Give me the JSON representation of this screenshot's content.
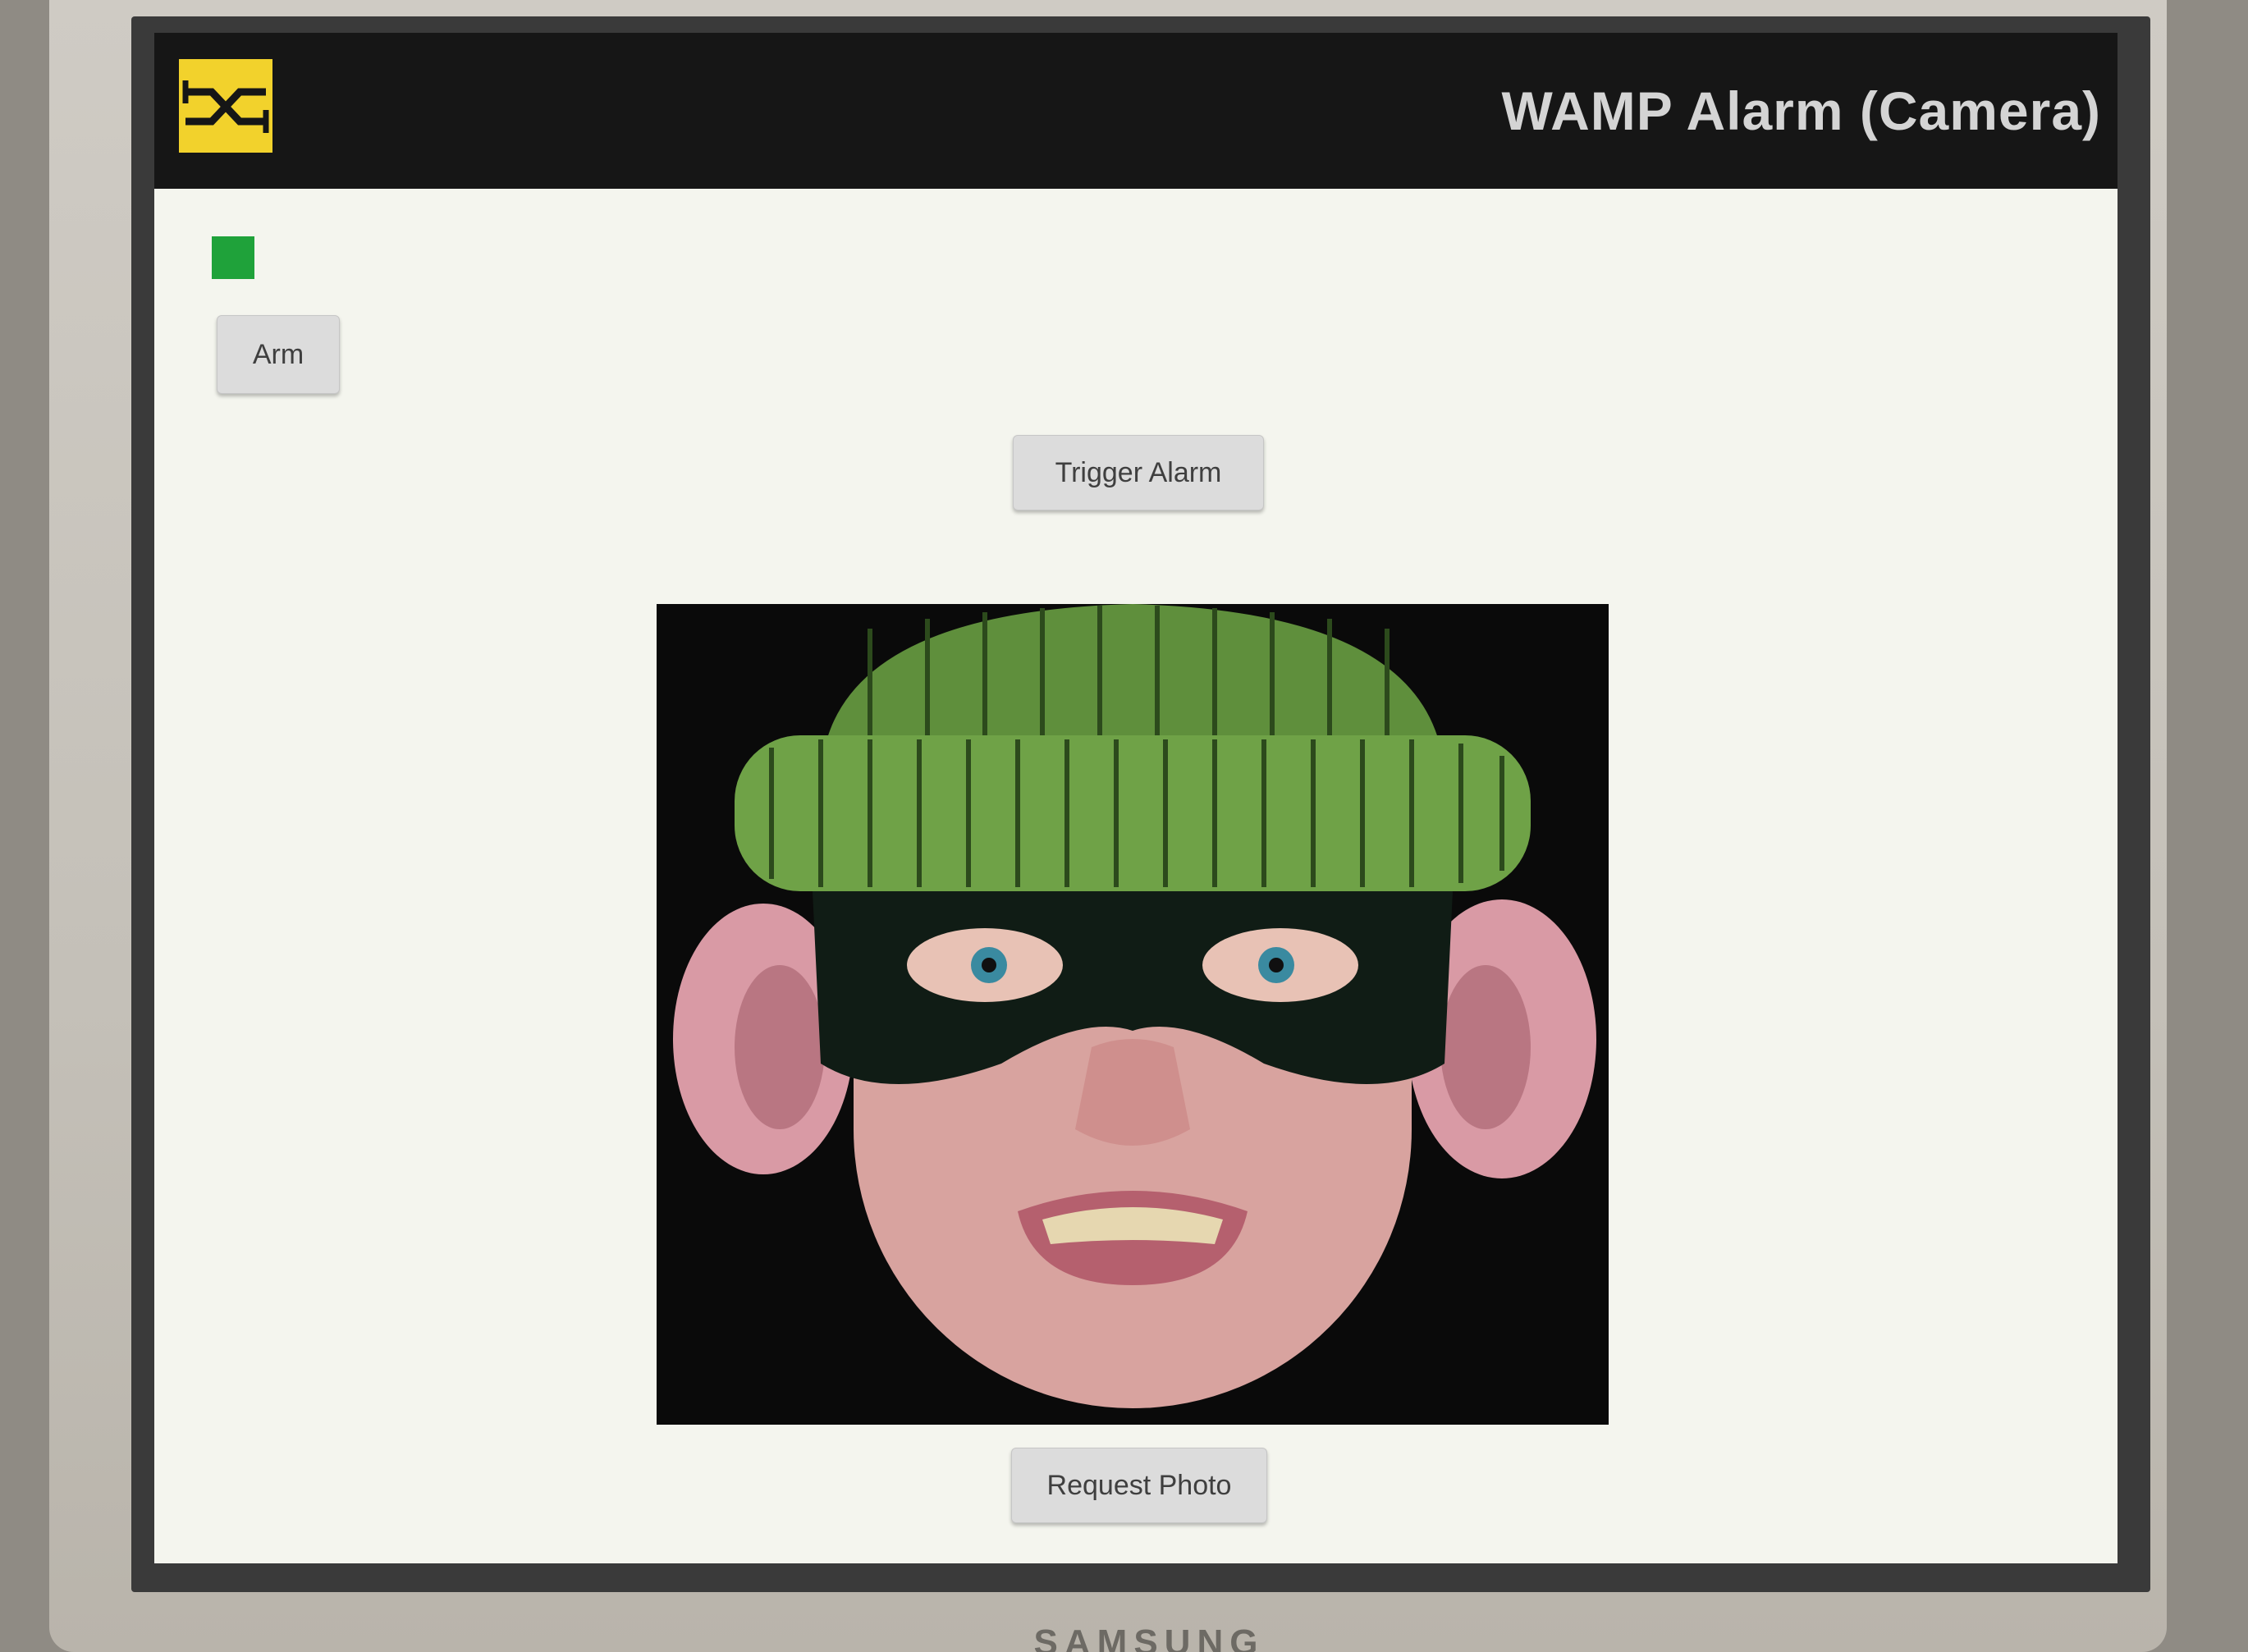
{
  "app": {
    "title": "WAMP Alarm (Camera)"
  },
  "status": {
    "indicator_color": "#1fa23a",
    "state": "disarmed"
  },
  "controls": {
    "arm_label": "Arm",
    "trigger_label": "Trigger Alarm",
    "request_photo_label": "Request Photo"
  },
  "monitor": {
    "brand": "SAMSUNG"
  },
  "icons": {
    "logo": "crossbar-logo-icon"
  }
}
